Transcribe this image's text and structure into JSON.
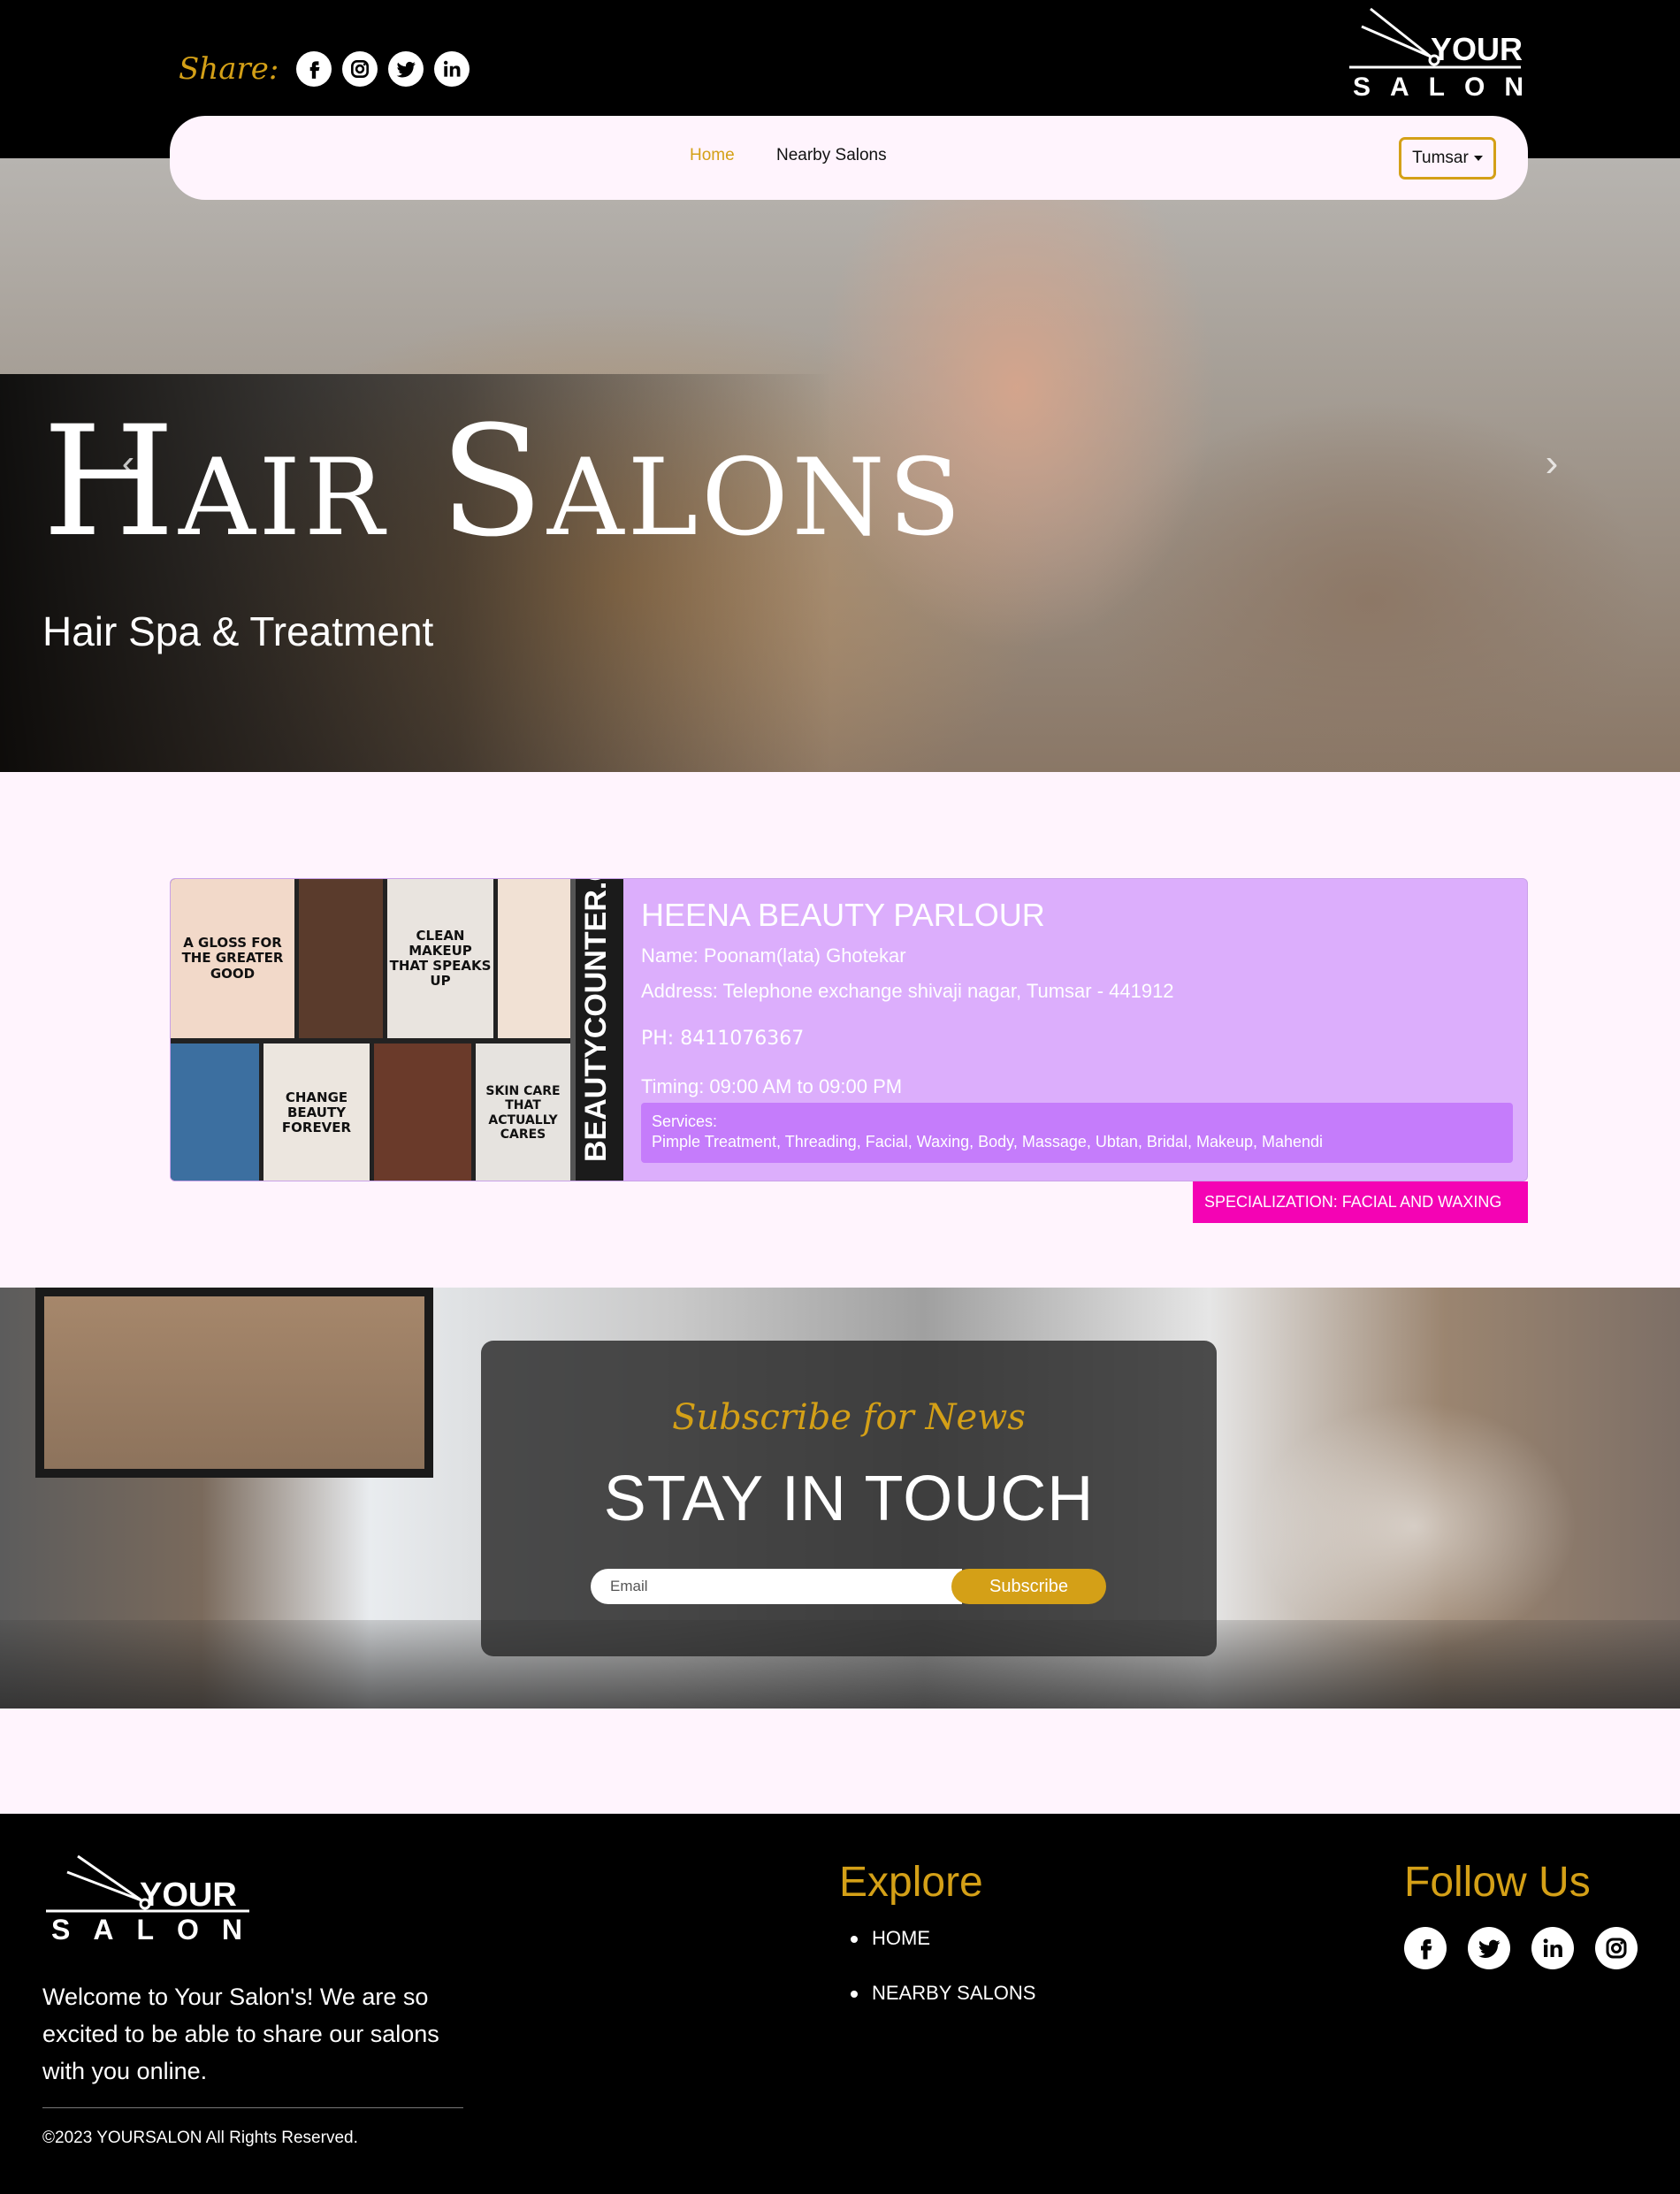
{
  "header": {
    "share_label": "Share:",
    "share_icons": [
      "facebook-icon",
      "instagram-icon",
      "twitter-icon",
      "linkedin-icon"
    ],
    "logo_text_top": "YOUR",
    "logo_text_bottom": "SALON"
  },
  "nav": {
    "home": "Home",
    "nearby": "Nearby Salons",
    "city_selected": "Tumsar"
  },
  "hero": {
    "title": "Hair Salons",
    "subtitle": "Hair Spa & Treatment",
    "prev_icon": "chevron-left-icon",
    "next_icon": "chevron-right-icon"
  },
  "parlour": {
    "title": "HEENA BEAUTY PARLOUR",
    "name": "Name: Poonam(lata) Ghotekar",
    "address": "Address: Telephone exchange shivaji nagar, Tumsar - 441912",
    "phone": "PH: 8411076367",
    "timing": "Timing: 09:00 AM to 09:00 PM",
    "services_label": "Services:",
    "services": "Pimple Treatment, Threading, Facial, Waxing, Body, Massage, Ubtan, Bridal, Makeup, Mahendi",
    "specialization": "SPECIALIZATION:  FACIAL AND WAXING",
    "image_texts": {
      "p1": "A GLOSS FOR THE GREATER GOOD",
      "p2": "CLEAN MAKEUP THAT SPEAKS UP",
      "p3": "CHANGE BEAUTY FOREVER",
      "p4": "SKIN CARE THAT ACTUALLY CARES",
      "side": "BEAUTYCOUNTER.COM"
    }
  },
  "subscribe": {
    "script": "Subscribe for News",
    "title": "STAY IN TOUCH",
    "email_placeholder": "Email",
    "button": "Subscribe"
  },
  "footer": {
    "welcome": "Welcome to Your Salon's! We are so excited to be able to share our salons with you online.",
    "copyright": "©2023 YOURSALON All Rights Reserved.",
    "explore_heading": "Explore",
    "explore_links": [
      "HOME",
      "NEARBY SALONS"
    ],
    "follow_heading": "Follow Us",
    "follow_icons": [
      "facebook-icon",
      "twitter-icon",
      "linkedin-icon",
      "instagram-icon"
    ]
  },
  "colors": {
    "accent": "#d4a017",
    "page_bg": "#fff4fd",
    "card_bg": "#dcaefc",
    "services_bg": "#c57cfb",
    "specialization_bg": "#f403b4"
  }
}
